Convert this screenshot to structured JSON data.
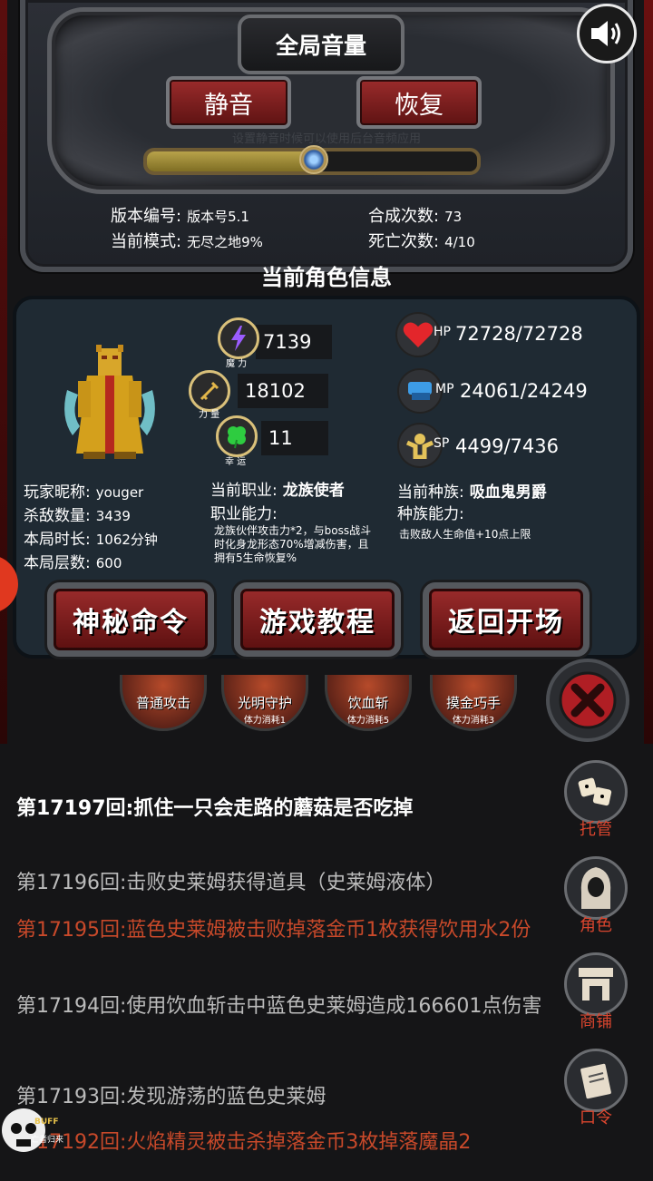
{
  "volume": {
    "title": "全局音量",
    "mute_label": "静音",
    "restore_label": "恢复",
    "hint": "设置静音时候可以使用后台音频应用",
    "level": 0.5
  },
  "game_info": {
    "version_label": "版本编号:",
    "version_value": "版本号5.1",
    "mode_label": "当前模式:",
    "mode_value": "无尽之地9%",
    "synth_label": "合成次数:",
    "synth_value": "73",
    "death_label": "死亡次数:",
    "death_value": "4/10"
  },
  "character": {
    "section_title": "当前角色信息",
    "stats": {
      "magic_label": "魔 力",
      "magic_value": "7139",
      "strength_label": "力 量",
      "strength_value": "18102",
      "luck_label": "幸 运",
      "luck_value": "11"
    },
    "resources": {
      "hp_label": "HP",
      "hp_value": "72728/72728",
      "mp_label": "MP",
      "mp_value": "24061/24249",
      "sp_label": "SP",
      "sp_value": "4499/7436"
    },
    "player": {
      "nickname_label": "玩家昵称:",
      "nickname_value": "youger",
      "kills_label": "杀敌数量:",
      "kills_value": "3439",
      "duration_label": "本局时长:",
      "duration_value": "1062分钟",
      "floors_label": "本局层数:",
      "floors_value": "600"
    },
    "job": {
      "label": "当前职业:",
      "value": "龙族使者",
      "ability_label": "职业能力:",
      "ability_desc": "龙族伙伴攻击力*2，与boss战斗时化身龙形态70%增减伤害，且拥有5生命恢复%"
    },
    "race": {
      "label": "当前种族:",
      "value": "吸血鬼男爵",
      "ability_label": "种族能力:",
      "ability_desc": "击败敌人生命值+10点上限"
    }
  },
  "actions": {
    "secret_command": "神秘命令",
    "tutorial": "游戏教程",
    "return_start": "返回开场"
  },
  "skills": [
    {
      "name": "普通攻击",
      "cost": ""
    },
    {
      "name": "光明守护",
      "cost": "体力消耗1"
    },
    {
      "name": "饮血斩",
      "cost": "体力消耗5"
    },
    {
      "name": "摸金巧手",
      "cost": "体力消耗3"
    }
  ],
  "log": [
    "第17197回:抓住一只会走路的蘑菇是否吃掉",
    "第17196回:击败史莱姆获得道具（史莱姆液体）",
    "第17195回:蓝色史莱姆被击败掉落金币1枚获得饮用水2份",
    "第17194回:使用饮血斩击中蓝色史莱姆造成166601点伤害",
    "第17193回:发现游荡的蓝色史莱姆",
    "第17192回:火焰精灵被击杀掉落金币3枚掉落魔晶2"
  ],
  "side_menu": {
    "auto": "托管",
    "character": "角色",
    "shop": "商铺",
    "password": "口令"
  },
  "buff": {
    "label": "BUFF",
    "sub": "亡者归来"
  },
  "colors": {
    "accent_red": "#c8492a",
    "button_red": "#8a2222",
    "gold": "#d9c07a"
  }
}
